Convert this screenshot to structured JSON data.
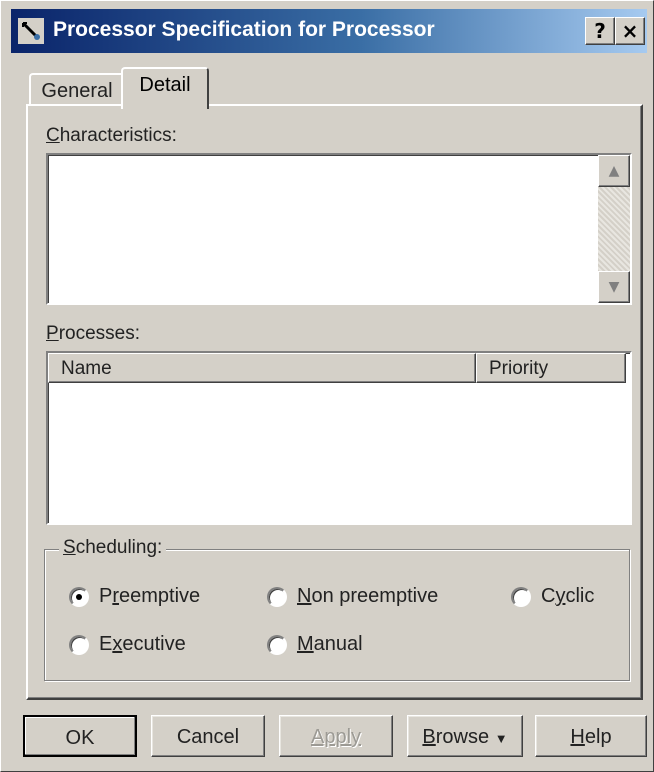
{
  "window": {
    "title": "Processor Specification for Processor",
    "help_label": "?",
    "close_label": "×"
  },
  "tabs": [
    {
      "label": "General",
      "selected": false
    },
    {
      "label": "Detail",
      "selected": true
    }
  ],
  "characteristics": {
    "label_hotkey": "C",
    "label_rest": "haracteristics:",
    "value": ""
  },
  "processes": {
    "label_hotkey": "P",
    "label_rest": "rocesses:",
    "columns": [
      "Name",
      "Priority"
    ],
    "rows": []
  },
  "scheduling": {
    "label_hotkey": "S",
    "label_rest": "cheduling:",
    "options": [
      {
        "pre": "P",
        "hot": "r",
        "post": "eemptive",
        "checked": true
      },
      {
        "pre": "",
        "hot": "N",
        "post": "on preemptive",
        "checked": false
      },
      {
        "pre": "C",
        "hot": "y",
        "post": "clic",
        "checked": false
      },
      {
        "pre": "E",
        "hot": "x",
        "post": "ecutive",
        "checked": false
      },
      {
        "pre": "",
        "hot": "M",
        "post": "anual",
        "checked": false
      }
    ]
  },
  "buttons": {
    "ok": "OK",
    "cancel": "Cancel",
    "apply": "Apply",
    "browse_hotkey": "B",
    "browse_rest": "rowse",
    "browse_arrow": "▼",
    "help_hotkey": "H",
    "help_rest": "elp"
  }
}
